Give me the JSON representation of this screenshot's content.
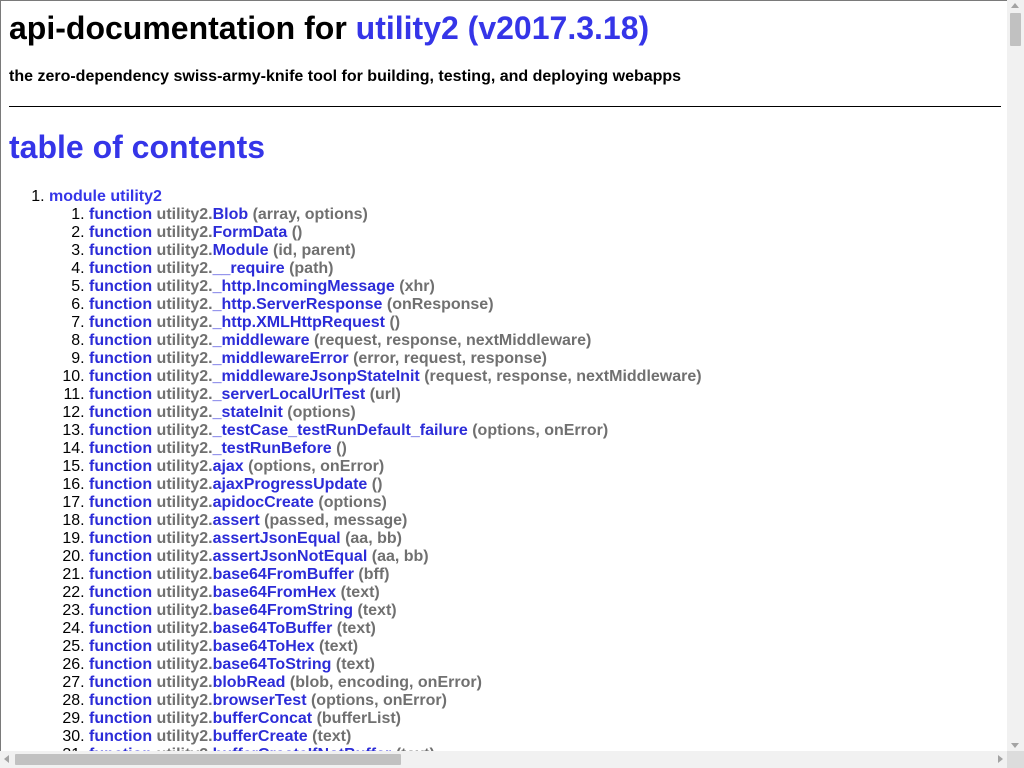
{
  "header": {
    "title_prefix": "api-documentation for ",
    "title_link": "utility2 (v2017.3.18)",
    "subtitle": "the zero-dependency swiss-army-knife tool for building, testing, and deploying webapps"
  },
  "toc": {
    "heading": "table of contents",
    "module_label": "module utility2",
    "keyword": "function",
    "owner": "utility2.",
    "functions": [
      {
        "name": "Blob",
        "sig": "(array, options)"
      },
      {
        "name": "FormData",
        "sig": "()"
      },
      {
        "name": "Module",
        "sig": "(id, parent)"
      },
      {
        "name": "__require",
        "sig": "(path)"
      },
      {
        "name": "_http.IncomingMessage",
        "sig": "(xhr)"
      },
      {
        "name": "_http.ServerResponse",
        "sig": "(onResponse)"
      },
      {
        "name": "_http.XMLHttpRequest",
        "sig": "()"
      },
      {
        "name": "_middleware",
        "sig": "(request, response, nextMiddleware)"
      },
      {
        "name": "_middlewareError",
        "sig": "(error, request, response)"
      },
      {
        "name": "_middlewareJsonpStateInit",
        "sig": "(request, response, nextMiddleware)"
      },
      {
        "name": "_serverLocalUrlTest",
        "sig": "(url)"
      },
      {
        "name": "_stateInit",
        "sig": "(options)"
      },
      {
        "name": "_testCase_testRunDefault_failure",
        "sig": "(options, onError)"
      },
      {
        "name": "_testRunBefore",
        "sig": "()"
      },
      {
        "name": "ajax",
        "sig": "(options, onError)"
      },
      {
        "name": "ajaxProgressUpdate",
        "sig": "()"
      },
      {
        "name": "apidocCreate",
        "sig": "(options)"
      },
      {
        "name": "assert",
        "sig": "(passed, message)"
      },
      {
        "name": "assertJsonEqual",
        "sig": "(aa, bb)"
      },
      {
        "name": "assertJsonNotEqual",
        "sig": "(aa, bb)"
      },
      {
        "name": "base64FromBuffer",
        "sig": "(bff)"
      },
      {
        "name": "base64FromHex",
        "sig": "(text)"
      },
      {
        "name": "base64FromString",
        "sig": "(text)"
      },
      {
        "name": "base64ToBuffer",
        "sig": "(text)"
      },
      {
        "name": "base64ToHex",
        "sig": "(text)"
      },
      {
        "name": "base64ToString",
        "sig": "(text)"
      },
      {
        "name": "blobRead",
        "sig": "(blob, encoding, onError)"
      },
      {
        "name": "browserTest",
        "sig": "(options, onError)"
      },
      {
        "name": "bufferConcat",
        "sig": "(bufferList)"
      },
      {
        "name": "bufferCreate",
        "sig": "(text)"
      },
      {
        "name": "bufferCreateIfNotBuffer",
        "sig": "(text)"
      }
    ]
  },
  "colors": {
    "link": "#3535e8",
    "muted": "#707070",
    "scrollbar_track": "#f1f1f1",
    "scrollbar_thumb": "#c1c1c1"
  },
  "scrollbars": {
    "vertical_position": 0.0,
    "horizontal_position": 0.0
  }
}
